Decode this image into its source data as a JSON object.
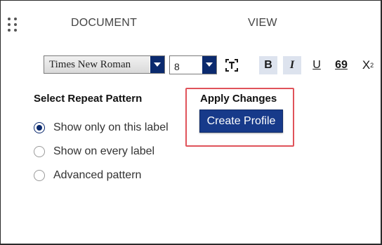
{
  "tabs": {
    "document": "DOCUMENT",
    "view": "VIEW"
  },
  "toolbar": {
    "font_family_value": "Times New Roman",
    "font_size_value": "8",
    "bold_label": "B",
    "italic_label": "I",
    "underline_label": "U",
    "special_label": "69",
    "subscript_label": "X",
    "subscript_suffix": "2",
    "bold_active": true,
    "italic_active": true
  },
  "repeat_pattern": {
    "title": "Select Repeat Pattern",
    "options": [
      {
        "label": "Show only on this label",
        "checked": true
      },
      {
        "label": "Show on every label",
        "checked": false
      },
      {
        "label": "Advanced pattern",
        "checked": false
      }
    ]
  },
  "apply": {
    "title": "Apply Changes",
    "button_label": "Create Profile"
  },
  "colors": {
    "accent": "#173a8a",
    "dropdown": "#0b2a6e",
    "highlight_border": "#e0535a"
  }
}
